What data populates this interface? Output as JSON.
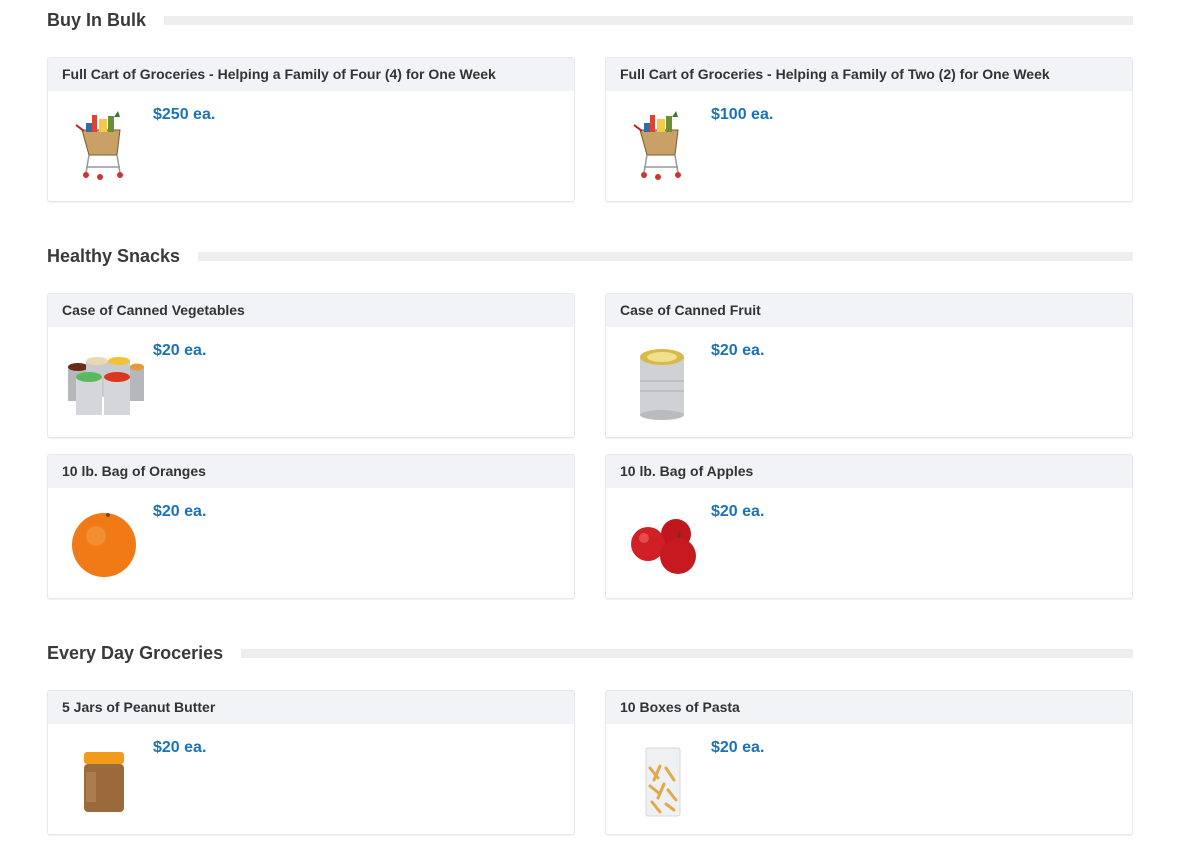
{
  "sections": [
    {
      "title": "Buy In Bulk",
      "items": [
        {
          "title": "Full Cart of Groceries - Helping a Family of Four (4) for One Week",
          "price": "$250 ea.",
          "icon": "grocery-cart-icon"
        },
        {
          "title": "Full Cart of Groceries - Helping a Family of Two (2) for One Week",
          "price": "$100 ea.",
          "icon": "grocery-cart-icon"
        }
      ]
    },
    {
      "title": "Healthy Snacks",
      "items": [
        {
          "title": "Case of Canned Vegetables",
          "price": "$20 ea.",
          "icon": "canned-vegetables-icon"
        },
        {
          "title": "Case of Canned Fruit",
          "price": "$20 ea.",
          "icon": "canned-fruit-icon"
        },
        {
          "title": "10 lb. Bag of Oranges",
          "price": "$20 ea.",
          "icon": "orange-icon"
        },
        {
          "title": "10 lb. Bag of Apples",
          "price": "$20 ea.",
          "icon": "apples-icon"
        }
      ]
    },
    {
      "title": "Every Day Groceries",
      "items": [
        {
          "title": "5 Jars of Peanut Butter",
          "price": "$20 ea.",
          "icon": "peanut-butter-jar-icon"
        },
        {
          "title": "10 Boxes of Pasta",
          "price": "$20 ea.",
          "icon": "pasta-bag-icon"
        }
      ]
    }
  ],
  "colors": {
    "price": "#1a73b8",
    "card_header_bg": "#f1f3f6",
    "section_rule": "#eceef0"
  }
}
